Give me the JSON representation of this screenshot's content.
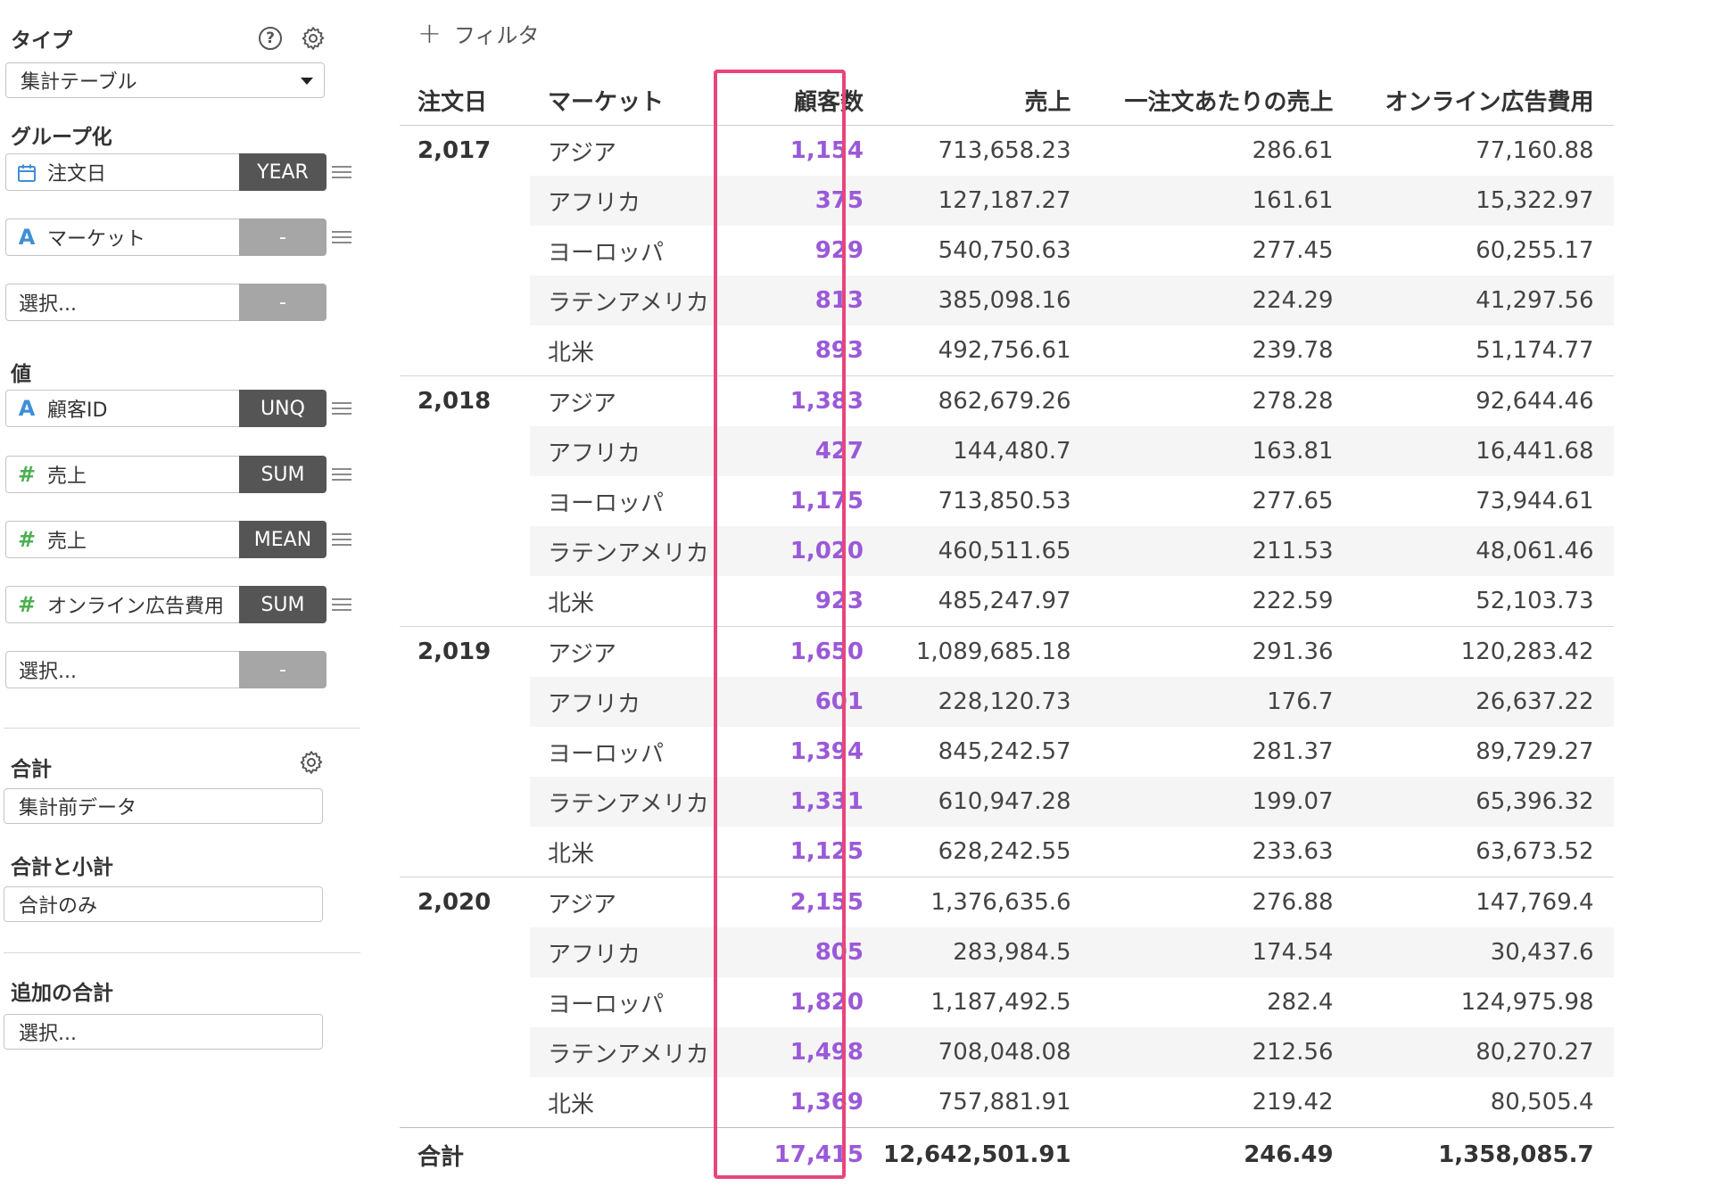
{
  "sidebar": {
    "type_label": "タイプ",
    "help_icon": "question-icon",
    "settings_icon": "gear-icon",
    "type_value": "集計テーブル",
    "grouping_label": "グループ化",
    "groups": [
      {
        "icon": "calendar-icon",
        "name": "注文日",
        "tag": "YEAR"
      },
      {
        "icon": "A",
        "name": "マーケット",
        "tag": "-"
      },
      {
        "icon": "",
        "name": "選択...",
        "tag": "-"
      }
    ],
    "values_label": "値",
    "values": [
      {
        "icon": "A",
        "name": "顧客ID",
        "tag": "UNQ"
      },
      {
        "icon": "#",
        "name": "売上",
        "tag": "SUM"
      },
      {
        "icon": "#",
        "name": "売上",
        "tag": "MEAN"
      },
      {
        "icon": "#",
        "name": "オンライン広告費用",
        "tag": "SUM"
      },
      {
        "icon": "",
        "name": "選択...",
        "tag": "-"
      }
    ],
    "total_label": "合計",
    "total_value": "集計前データ",
    "subtotal_label": "合計と小計",
    "subtotal_value": "合計のみ",
    "extra_total_label": "追加の合計",
    "extra_total_value": "選択..."
  },
  "filter_label": "フィルタ",
  "table": {
    "headers": [
      "注文日",
      "マーケット",
      "顧客数",
      "売上",
      "一注文あたりの売上",
      "オンライン広告費用"
    ],
    "groups": [
      {
        "year": "2,017",
        "rows": [
          [
            "アジア",
            "1,154",
            "713,658.23",
            "286.61",
            "77,160.88"
          ],
          [
            "アフリカ",
            "375",
            "127,187.27",
            "161.61",
            "15,322.97"
          ],
          [
            "ヨーロッパ",
            "929",
            "540,750.63",
            "277.45",
            "60,255.17"
          ],
          [
            "ラテンアメリカ",
            "813",
            "385,098.16",
            "224.29",
            "41,297.56"
          ],
          [
            "北米",
            "893",
            "492,756.61",
            "239.78",
            "51,174.77"
          ]
        ]
      },
      {
        "year": "2,018",
        "rows": [
          [
            "アジア",
            "1,383",
            "862,679.26",
            "278.28",
            "92,644.46"
          ],
          [
            "アフリカ",
            "427",
            "144,480.7",
            "163.81",
            "16,441.68"
          ],
          [
            "ヨーロッパ",
            "1,175",
            "713,850.53",
            "277.65",
            "73,944.61"
          ],
          [
            "ラテンアメリカ",
            "1,020",
            "460,511.65",
            "211.53",
            "48,061.46"
          ],
          [
            "北米",
            "923",
            "485,247.97",
            "222.59",
            "52,103.73"
          ]
        ]
      },
      {
        "year": "2,019",
        "rows": [
          [
            "アジア",
            "1,650",
            "1,089,685.18",
            "291.36",
            "120,283.42"
          ],
          [
            "アフリカ",
            "601",
            "228,120.73",
            "176.7",
            "26,637.22"
          ],
          [
            "ヨーロッパ",
            "1,394",
            "845,242.57",
            "281.37",
            "89,729.27"
          ],
          [
            "ラテンアメリカ",
            "1,331",
            "610,947.28",
            "199.07",
            "65,396.32"
          ],
          [
            "北米",
            "1,125",
            "628,242.55",
            "233.63",
            "63,673.52"
          ]
        ]
      },
      {
        "year": "2,020",
        "rows": [
          [
            "アジア",
            "2,155",
            "1,376,635.6",
            "276.88",
            "147,769.4"
          ],
          [
            "アフリカ",
            "805",
            "283,984.5",
            "174.54",
            "30,437.6"
          ],
          [
            "ヨーロッパ",
            "1,820",
            "1,187,492.5",
            "282.4",
            "124,975.98"
          ],
          [
            "ラテンアメリカ",
            "1,498",
            "708,048.08",
            "212.56",
            "80,270.27"
          ],
          [
            "北米",
            "1,369",
            "757,881.91",
            "219.42",
            "80,505.4"
          ]
        ]
      }
    ],
    "total": [
      "合計",
      "17,415",
      "12,642,501.91",
      "246.49",
      "1,358,085.7"
    ]
  },
  "colors": {
    "count": "#9b59d8",
    "highlight": "#e8457a",
    "tag_dark": "#555555",
    "tag_light": "#a6a6a6"
  }
}
